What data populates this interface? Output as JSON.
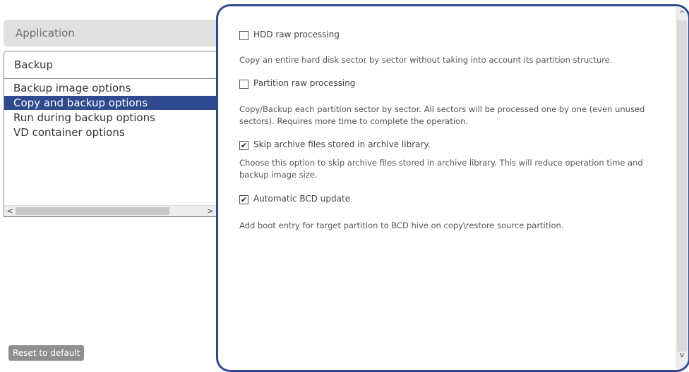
{
  "sidebar": {
    "header": "Application",
    "subheader": "Backup",
    "items": [
      {
        "label": "Backup image options"
      },
      {
        "label": "Copy and backup options",
        "selected": true
      },
      {
        "label": "Run during backup options"
      },
      {
        "label": "VD container options"
      }
    ],
    "reset_label": "Reset to default"
  },
  "options": [
    {
      "label": "HDD raw processing",
      "checked": false,
      "description": "Copy an entire hard disk sector by sector without taking into account its partition structure."
    },
    {
      "label": "Partition raw processing",
      "checked": false,
      "description": "Copy/Backup each partition sector by sector. All sectors will be processed one by one (even unused sectors). Requires more time to complete the operation."
    },
    {
      "label": "Skip archive files stored in archive library.",
      "checked": true,
      "description": "Choose this option to skip archive files stored in archive library. This will reduce operation time and backup image size."
    },
    {
      "label": "Automatic BCD update",
      "checked": true,
      "description": "Add boot entry for target partition to BCD hive on copy\\restore source partition."
    }
  ],
  "colors": {
    "accent": "#2f4a8f",
    "header_bg": "#e1e1e1",
    "reset_bg": "#8f8f8f"
  }
}
